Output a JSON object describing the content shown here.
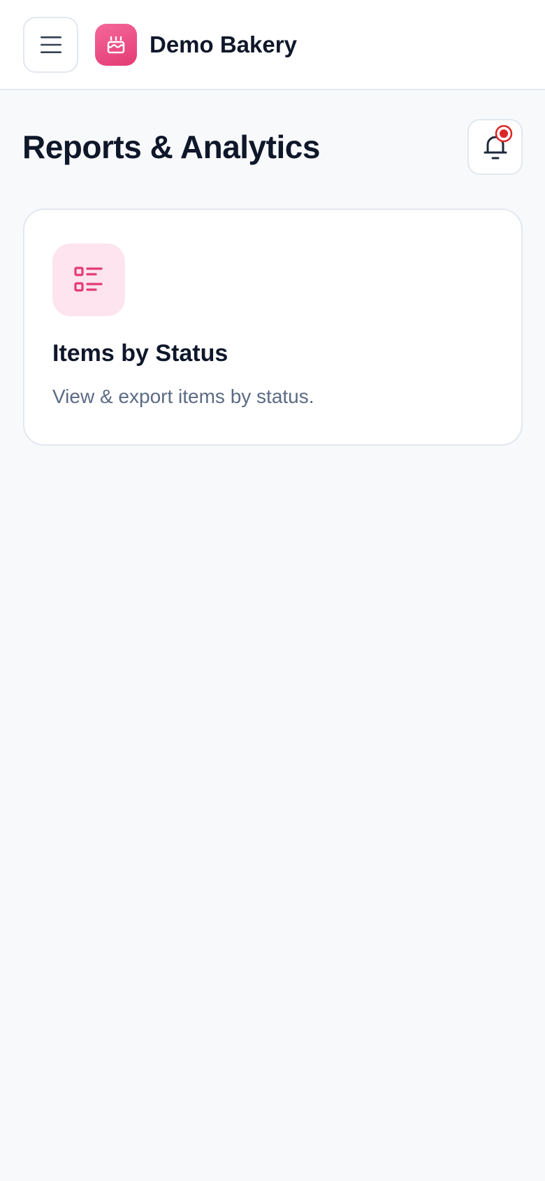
{
  "header": {
    "menu_icon": "hamburger-menu-icon",
    "brand_icon": "birthday-cake-icon",
    "brand_name": "Demo Bakery"
  },
  "page": {
    "title": "Reports & Analytics",
    "notification_icon": "bell-icon",
    "has_unread_notifications": true
  },
  "reports": [
    {
      "icon": "list-details-icon",
      "title": "Items by Status",
      "description": "View & export items by status."
    }
  ],
  "colors": {
    "accent": "#e33b74",
    "accent_light": "#fde4ee",
    "text_primary": "#0f172a",
    "text_secondary": "#5b6b85",
    "notification_badge": "#dc2626",
    "border": "#e2e8f0",
    "background": "#f8f9fb"
  }
}
